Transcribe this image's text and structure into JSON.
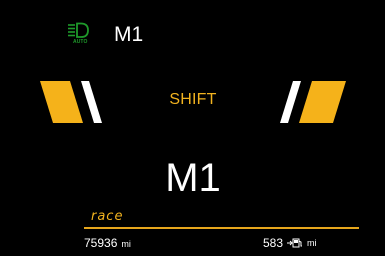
{
  "cluster": {
    "lamp_indicator": {
      "icon": "auto-headlamp-icon",
      "label": "AUTO",
      "color": "#1e9a2a"
    },
    "mode_top": "M1",
    "shift_text": "SHIFT",
    "gear": "M1",
    "drive_mode": "race",
    "odometer": {
      "value": "75936",
      "unit": "mi"
    },
    "range": {
      "value": "583",
      "icon": "fuel-pump-icon",
      "unit": "mi"
    },
    "colors": {
      "accent": "#f2b31f",
      "background": "#000000",
      "text": "#ffffff",
      "shift_light_white": "#ffffff",
      "shift_light_amber": "#f5b21a"
    }
  }
}
